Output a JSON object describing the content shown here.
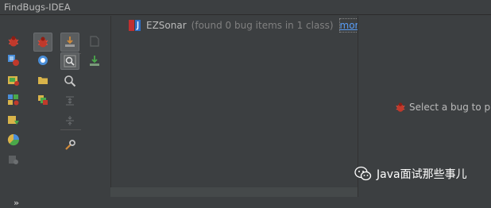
{
  "window": {
    "title": "FindBugs-IDEA"
  },
  "results": {
    "class_name": "EZSonar",
    "summary": "(found 0 bug items in 1 class)",
    "more_link": "more..."
  },
  "detail": {
    "placeholder": "Select a bug to pr"
  },
  "toolbar": {
    "expand_glyph": "»",
    "column1": [
      "bug-run-icon",
      "run-module-icon",
      "analyze-package-icon",
      "analyze-modules-icon",
      "analyze-changed-icon",
      "analyze-scope-icon",
      "analyze-disabled-icon"
    ],
    "column2": [
      "run-selected-bug-icon",
      "bug-info-icon",
      "folder-icon",
      "multi-file-icon"
    ],
    "column3": [
      "import-icon",
      "group-search-icon",
      "zoom-icon",
      "expand-all-icon",
      "collapse-all-icon",
      "settings-wrench-icon"
    ],
    "column4": [
      "export-icon",
      "download-icon"
    ]
  },
  "watermark": {
    "text": "Java面试那些事儿"
  },
  "colors": {
    "background": "#3c3f41",
    "link": "#589df6",
    "muted_text": "#808080",
    "bug_red": "#c0392b"
  }
}
